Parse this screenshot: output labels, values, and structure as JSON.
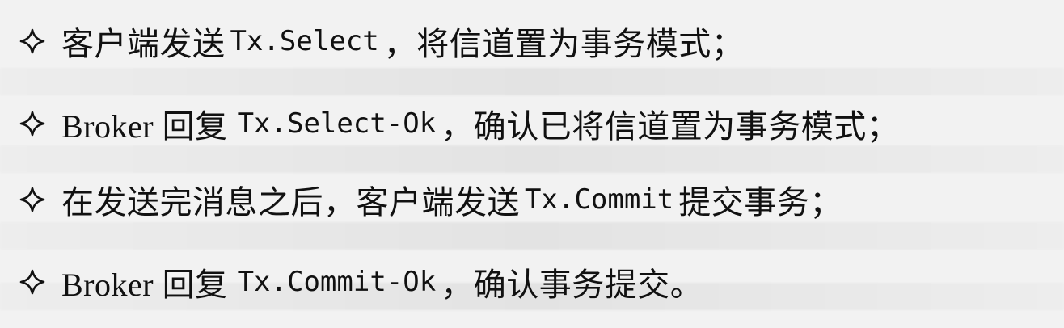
{
  "items": [
    {
      "pre": "客户端发送",
      "code": "Tx.Select",
      "post": "，将信道置为事务模式；"
    },
    {
      "pre": "Broker 回复",
      "code": "Tx.Select-Ok",
      "post": "，确认已将信道置为事务模式；"
    },
    {
      "pre": "在发送完消息之后，客户端发送",
      "code": "Tx.Commit",
      "post": "提交事务；"
    },
    {
      "pre": "Broker 回复",
      "code": "Tx.Commit-Ok",
      "post": "，确认事务提交。"
    }
  ],
  "icons": {
    "bullet": "diamond-star-icon"
  }
}
